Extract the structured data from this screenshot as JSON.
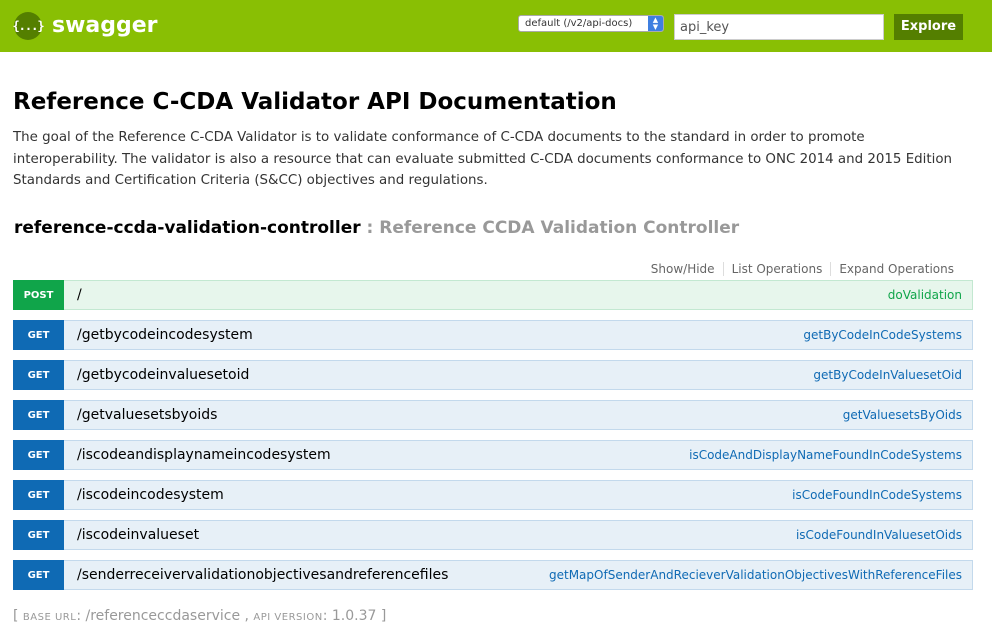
{
  "header": {
    "logo_glyph": "{...}",
    "logo_text": "swagger",
    "spec_selected": "default (/v2/api-docs)",
    "api_key_placeholder": "api_key",
    "explore_label": "Explore",
    "colors": {
      "bar": "#89bf04",
      "button": "#547f00"
    }
  },
  "info": {
    "title": "Reference C-CDA Validator API Documentation",
    "description": "The goal of the Reference C-CDA Validator is to validate conformance of C-CDA documents to the standard in order to promote interoperability. The validator is also a resource that can evaluate submitted C-CDA documents conformance to ONC 2014 and 2015 Edition Standards and Certification Criteria (S&CC) objectives and regulations."
  },
  "controller": {
    "name": "reference-ccda-validation-controller",
    "separator": " : ",
    "description": "Reference CCDA Validation Controller",
    "links": [
      "Show/Hide",
      "List Operations",
      "Expand Operations"
    ]
  },
  "operations": [
    {
      "method": "POST",
      "path": "/",
      "name": "doValidation"
    },
    {
      "method": "GET",
      "path": "/getbycodeincodesystem",
      "name": "getByCodeInCodeSystems"
    },
    {
      "method": "GET",
      "path": "/getbycodeinvaluesetoid",
      "name": "getByCodeInValuesetOid"
    },
    {
      "method": "GET",
      "path": "/getvaluesetsbyoids",
      "name": "getValuesetsByOids"
    },
    {
      "method": "GET",
      "path": "/iscodeandisplaynameincodesystem",
      "name": "isCodeAndDisplayNameFoundInCodeSystems"
    },
    {
      "method": "GET",
      "path": "/iscodeincodesystem",
      "name": "isCodeFoundInCodeSystems"
    },
    {
      "method": "GET",
      "path": "/iscodeinvalueset",
      "name": "isCodeFoundInValuesetOids"
    },
    {
      "method": "GET",
      "path": "/senderreceivervalidationobjectivesandreferencefiles",
      "name": "getMapOfSenderAndRecieverValidationObjectivesWithReferenceFiles"
    }
  ],
  "footer": {
    "open": "[ ",
    "base_url_label": "BASE URL",
    "base_url_colon": ": ",
    "base_url": "/referenceccdaservice",
    "sep": " , ",
    "api_version_label": "API VERSION",
    "api_version_colon": ": ",
    "api_version": "1.0.37",
    "close": " ]"
  }
}
